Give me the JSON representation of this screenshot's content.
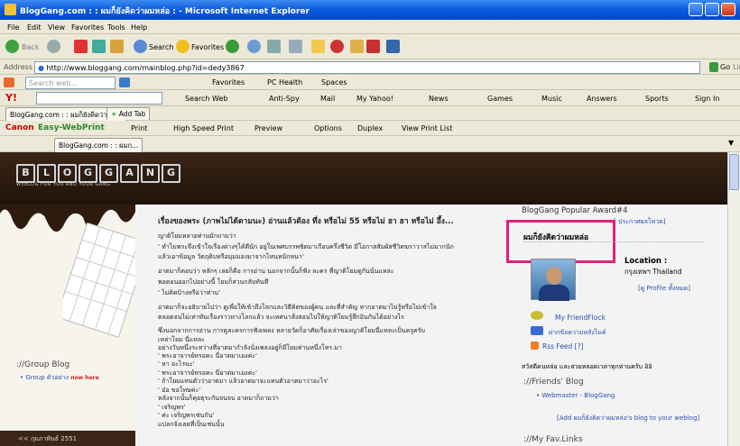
{
  "window": {
    "title": "BlogGang.com : : ผมก็ยังคิดว่าผมหล่อ : - Microsoft Internet Explorer"
  },
  "menu": [
    "File",
    "Edit",
    "View",
    "Favorites",
    "Tools",
    "Help"
  ],
  "toolbar": {
    "back": "Back",
    "search": "Search",
    "favorites": "Favorites"
  },
  "address": {
    "label": "Address",
    "url": "http://www.bloggang.com/mainblog.php?id=dedy3867",
    "go": "Go",
    "links": "Lin"
  },
  "msnbar": {
    "search_placeholder": "Search web...",
    "favorites": "Favorites",
    "pchealth": "PC Health",
    "spaces": "Spaces"
  },
  "yahoobar": {
    "search_web": "Search Web",
    "antispy": "Anti-Spy",
    "mail": "Mail",
    "myyahoo": "My Yahoo!",
    "news": "News",
    "games": "Games",
    "music": "Music",
    "answers": "Answers",
    "sports": "Sports",
    "signin": "Sign In"
  },
  "tabs": {
    "current": "BlogGang.com : : ผมก็ยังคิดว่าผม...",
    "add": "Add Tab"
  },
  "canon": {
    "brand": "Canon",
    "product": "Easy-WebPrint",
    "print": "Print",
    "hsprint": "High Speed Print",
    "preview": "Preview",
    "options": "Options",
    "duplex": "Duplex",
    "viewlist": "View Print List"
  },
  "favtab": {
    "label": "BlogGang.com : : ผมก..."
  },
  "blog": {
    "logo_letters": [
      "B",
      "L",
      "O",
      "G",
      "G",
      "A",
      "N",
      "G"
    ],
    "logo_sub": "WEBLOG FOR YOU AND YOUR GANG",
    "post_title": "เรื่องของพระ (ภาพไม่ได้ตามนะ) อ่านแล้วต้อง ทึ่ง หรือไม่ 55 หรือไม่ ฮา ฮา หรือไม่ อึ้ง...",
    "post_lines": [
      "ญาติโยมหลายท่านมักถามว่า",
      "' ทำไมพระจึงเข้าใจเรื่องต่างๆได้ดีนัก อยู่ในเพศบรรพชิตมาเกือบครึ่งชีวิต มีโอกาสสัมผัสชีวิตฆราวาสไม่มากนัก",
      "แล้วเอาข้อมูล วัตถุดิบหรือมุมมองมาจากไหนหนักหนา'",
      "อาตมาก็ตอบว่า หลักๆ เลยก็คือ การอ่าน นอกจากนั้นก็ฟัง ละคร ที่ญาติโยมดูกันนั่นแหละ",
      "พอดอนออกไปอย่างนี้ โยมก็สวนกลับทันที",
      "' ไม่คิดบ้างหรือว่าท่าน'",
      "อาตมาก็จะอธิบายไปว่า ดูเพื่อให้เข้าถึงโลกและวิธีคิดของผู้คน และที่สำคัญ หากอาตมาไม่รู้หรือไม่เข้าใจ",
      "ตลอดจนไม่เท่าทันเรื่องราวทางโลกแล้ว จะเทศนาสั่งสอนไปให้ญาติโยมรู้สึกอินกันได้อย่างไร",
      "ซึ่งนอกจากการอ่าน การดูละครการฟังเพลง หลายวัดก็อาศัยเรื่องเล่าของญาติโยมนี่แหละเป็นครูครับ",
      "เหล่าโยม นี่แหละ",
      "อย่างวันหนึ่งระหว่างที่อาตมากำลังนั่งเพลงอยู่ก็มีโยมท่านหนึ่งโทร.มา",
      "' พระอาจารย์หรอคะ นี่อาตมาเองค่ะ'",
      "' หา อะไรนะ'",
      "' พระอาจารย์หรอคะ นี่อาตมาเองค่ะ'",
      "' ถ้าโยมแทนตัวว่าอาตมา แล้วอาตมาจะแทนตัวอาตมาว่าอะไร'",
      "' อ๋อ ขอโทษค่ะ'",
      "หลังจากนั้นก็คุยธุระกันจนจบ อาตมาก็ถามว่า",
      "' เจริญพร'",
      "' ค่ะ เจริญพรเช่นกัน'",
      "แปลกจังเลยที่เป็นเช่นนั้น"
    ],
    "group_blog_title": "://Group Blog",
    "group_blog_item": "Group ตัวอย่าง",
    "group_blog_new": "now here",
    "month_nav": "<<   กุมภาพันธ์ 2551",
    "award_title": "BlogGang Popular Award#4",
    "award_link": "[ ประกาศผลโหวต]",
    "blog_name": "ผมก็ยังคิดว่าผมหล่อ",
    "location_label": "Location :",
    "location_value": "กรุงเทพฯ Thailand",
    "profile_link": "[ดู Profile ทั้งหมด]",
    "friendflock": "My FriendFlock",
    "send_msg": "ฝากข้อความหลังไมค์",
    "rss": "Rss Feed [?]",
    "greeting": "สวัสดีคนหล่อ และสวยหลอดเวลาทุกท่านครับ อิอิ",
    "friends_title": "://Friends' Blog",
    "webmaster": "Webmaster - BlogGang",
    "add_link": "[Add ผมก็ยังคิดว่าผมหล่อ's blog to your weblog]",
    "fav_links": "://My Fav.Links"
  },
  "colors": {
    "titlebar": "#0a5ae0",
    "highlight_box": "#e0207a",
    "banner": "#2d1b0e"
  }
}
